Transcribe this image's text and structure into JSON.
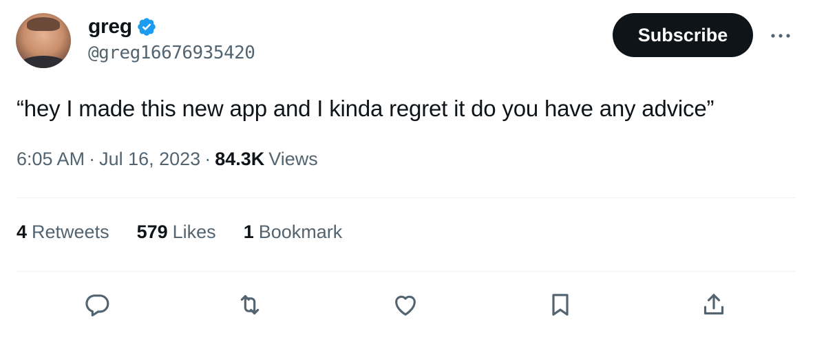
{
  "author": {
    "name": "greg",
    "handle": "@greg16676935420",
    "verified": true,
    "avatar_icon": "avatar-photo"
  },
  "header": {
    "subscribe_label": "Subscribe",
    "more_icon": "more-horizontal-icon"
  },
  "tweet": {
    "text": "“hey I made this new app and I kinda regret it do you have any advice”",
    "time": "6:05 AM",
    "date": "Jul 16, 2023",
    "separator": "·",
    "views_count": "84.3K",
    "views_label": "Views"
  },
  "stats": {
    "retweets_count": "4",
    "retweets_label": "Retweets",
    "likes_count": "579",
    "likes_label": "Likes",
    "bookmarks_count": "1",
    "bookmarks_label": "Bookmark"
  },
  "actions": [
    "reply-icon",
    "retweet-icon",
    "like-icon",
    "bookmark-icon",
    "share-icon"
  ],
  "colors": {
    "text_primary": "#0f1419",
    "text_secondary": "#536471",
    "verified_blue": "#1d9bf0",
    "button_bg": "#0f1419",
    "divider": "#eff3f4"
  }
}
